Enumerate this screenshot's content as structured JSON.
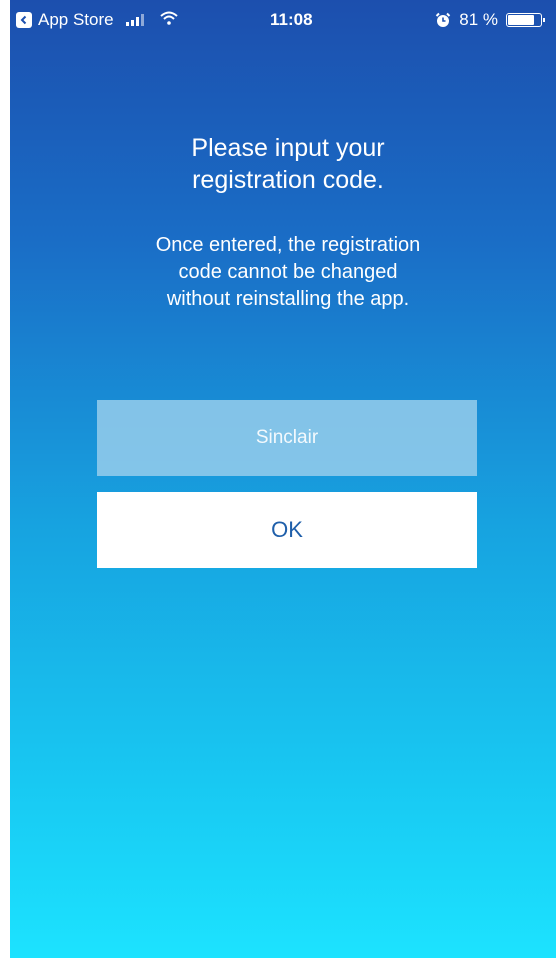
{
  "status_bar": {
    "back_app_label": "App Store",
    "time": "11:08",
    "battery_percent": "81 %",
    "battery_level": 0.81
  },
  "dialog": {
    "title": "Please input your\nregistration code.",
    "message": "Once entered, the registration\ncode cannot be changed\nwithout reinstalling the app.",
    "input_placeholder": "Sinclair",
    "ok_label": "OK"
  },
  "colors": {
    "gradient_top": "#1c4fae",
    "gradient_bottom": "#1ce3ff",
    "input_bg": "#96cdeb",
    "ok_text": "#1f5faa"
  },
  "icons": [
    "back-arrow-icon",
    "signal-icon",
    "wifi-icon",
    "alarm-icon",
    "battery-icon"
  ]
}
